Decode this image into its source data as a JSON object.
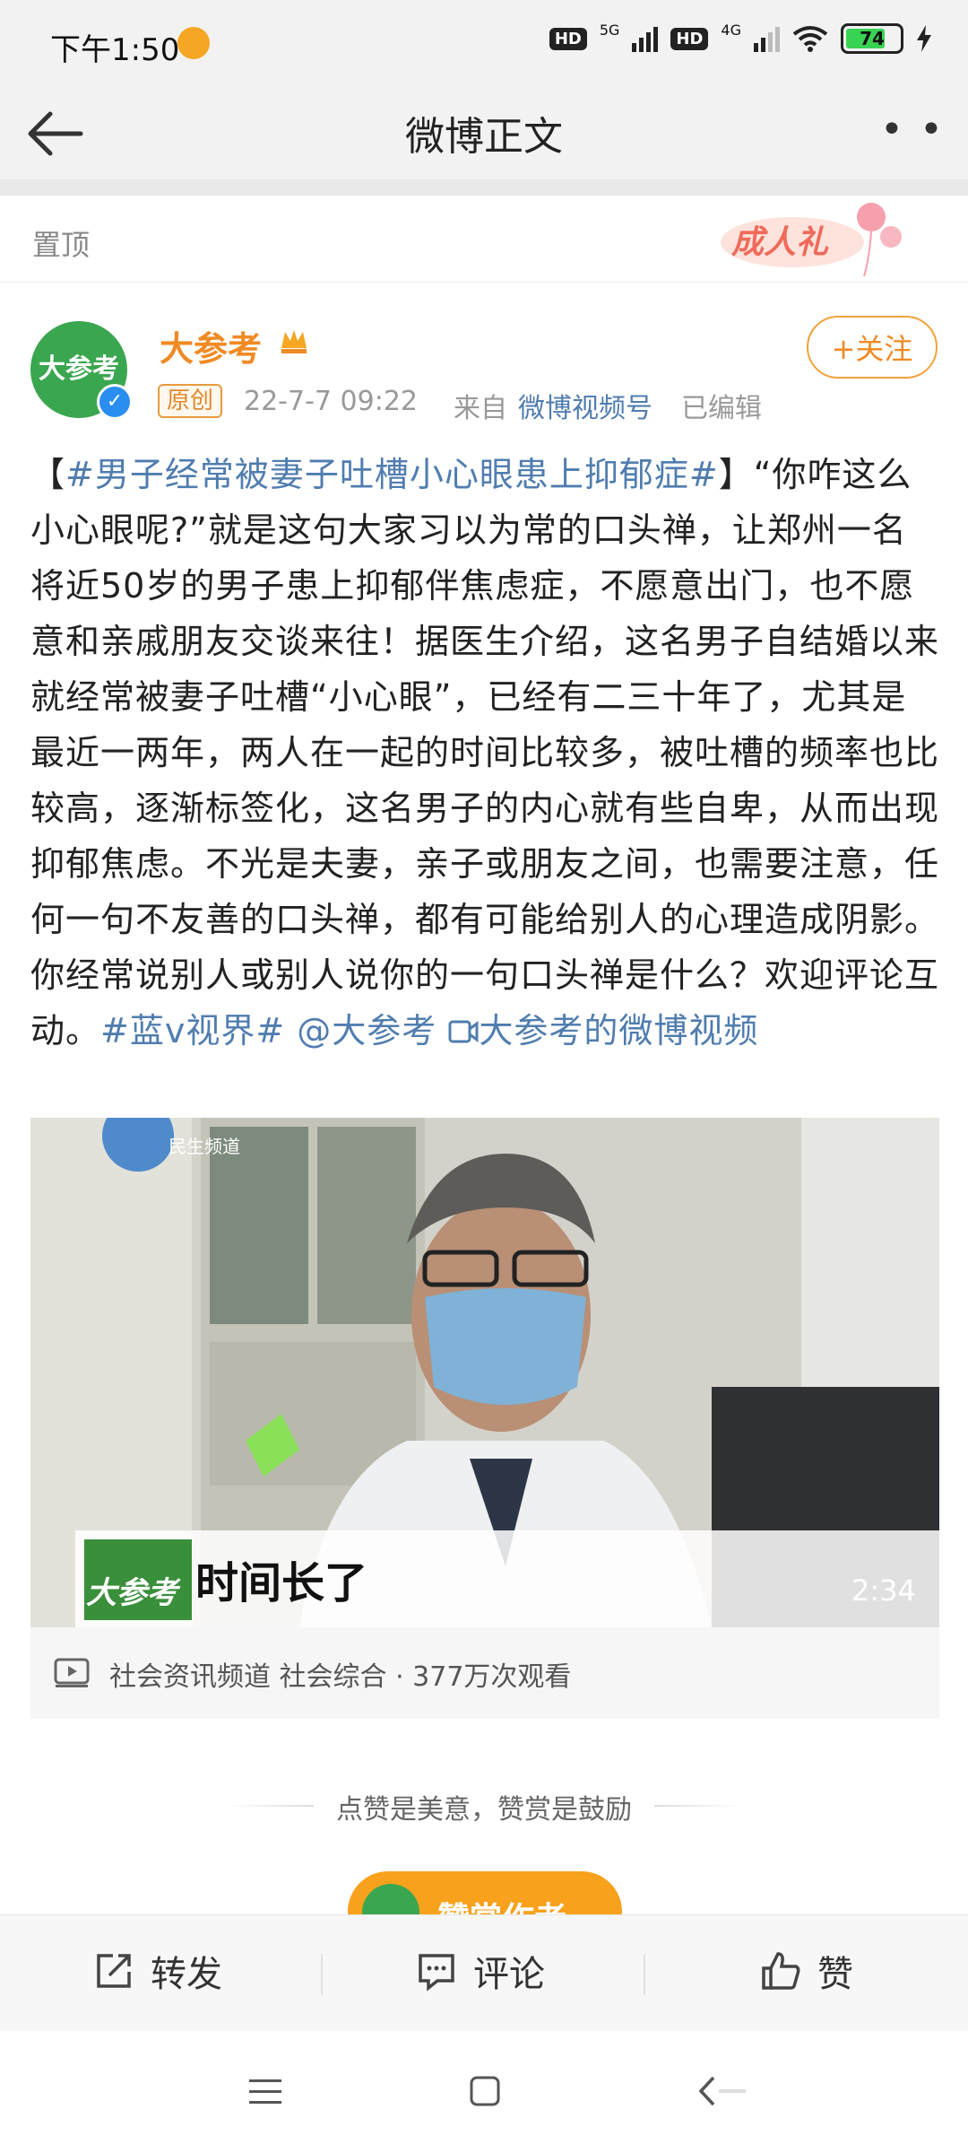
{
  "status_bar": {
    "time": "下午1:50",
    "hd1": "HD",
    "net1": "5G",
    "hd2": "HD",
    "net2": "4G",
    "battery": "74",
    "battery_level": 0.74
  },
  "header": {
    "title": "微博正文",
    "back_icon": "back-arrow-icon",
    "more_icon": "more-icon"
  },
  "pinned": {
    "label": "置顶",
    "badge": "成人礼"
  },
  "author": {
    "name": "大参考",
    "avatar_text": "大参考",
    "tag": "原创",
    "time": "22-7-7 09:22",
    "from_label": "来自",
    "source": "微博视频号",
    "edited": "已编辑",
    "follow_label": "+关注"
  },
  "post": {
    "bracket_open": "【",
    "hashtag_main": "#男子经常被妻子吐槽小心眼患上抑郁症#",
    "bracket_close": "】",
    "body": "“你咋这么小心眼呢?”就是这句大家习以为常的口头禅，让郑州一名将近50岁的男子患上抑郁伴焦虑症，不愿意出门，也不愿意和亲戚朋友交谈来往！据医生介绍，这名男子自结婚以来就经常被妻子吐槽“小心眼”，已经有二三十年了，尤其是最近一两年，两人在一起的时间比较多，被吐槽的频率也比较高，逐渐标签化，这名男子的内心就有些自卑，从而出现抑郁焦虑。不光是夫妻，亲子或朋友之间，也需要注意，任何一句不友善的口头禅，都有可能给别人的心理造成阴影。你经常说别人或别人说你的一句口头禅是什么？欢迎评论互动。",
    "hashtag_end": "#蓝v视界#",
    "mention": "@大参考",
    "video_link": "大参考的微博视频"
  },
  "video": {
    "caption": "时间长了",
    "logo": "大参考",
    "channel_logo": "民生频道",
    "duration": "2:34",
    "meta": "社会资讯频道 社会综合 · 377万次观看"
  },
  "encourage": {
    "text": "点赞是美意，赞赏是鼓励",
    "reward_label": "赞赏作者"
  },
  "actions": {
    "repost": "转发",
    "comment": "评论",
    "like": "赞"
  }
}
